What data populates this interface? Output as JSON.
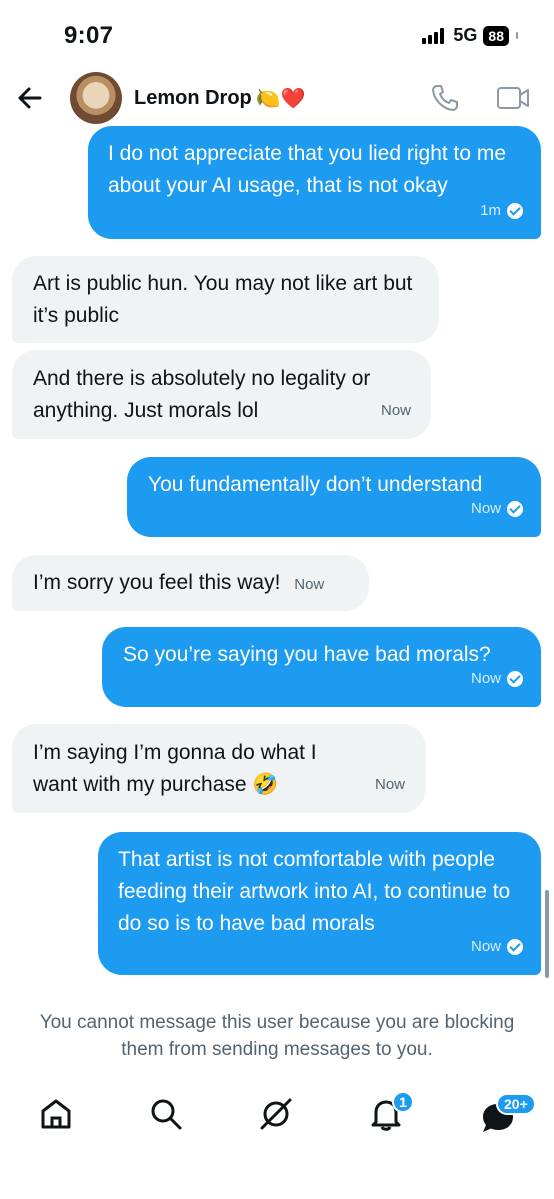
{
  "status_bar": {
    "time": "9:07",
    "network": "5G",
    "battery": "88"
  },
  "header": {
    "name": "Lemon Drop",
    "name_emoji": "🍋❤️"
  },
  "messages": [
    {
      "direction": "sent",
      "text": "I do not appreciate that you lied right to me about your AI usage, that is not okay",
      "time": "1m",
      "read": true
    },
    {
      "direction": "received",
      "text": "Art is public hun. You may not like art but it’s public",
      "time": ""
    },
    {
      "direction": "received",
      "text": "And there is absolutely no legality or anything. Just morals lol",
      "time": "Now"
    },
    {
      "direction": "sent",
      "text": "You fundamentally don’t understand",
      "time": "Now",
      "read": true
    },
    {
      "direction": "received",
      "text": "I’m sorry you feel this way!",
      "time": "Now"
    },
    {
      "direction": "sent",
      "text": "So you’re saying you have bad morals?",
      "time": "Now",
      "read": true
    },
    {
      "direction": "received",
      "text": "I’m saying I’m gonna do what I want with my purchase 🤣",
      "time": "Now"
    },
    {
      "direction": "sent",
      "text": "That artist is not comfortable with people feeding their artwork into AI, to continue to do so is to have bad morals",
      "time": "Now",
      "read": true
    }
  ],
  "notice": "You cannot message this user because you are blocking them from sending messages to you.",
  "bottom_nav": {
    "notifications_badge": "1",
    "messages_badge": "20+"
  },
  "colors": {
    "accent": "#1d9bf0",
    "received_bg": "#eff3f4",
    "secondary_text": "#536471"
  },
  "icons": [
    "back-arrow-icon",
    "phone-icon",
    "video-call-icon",
    "home-icon",
    "search-icon",
    "grok-icon",
    "notifications-bell-icon",
    "messages-icon"
  ]
}
